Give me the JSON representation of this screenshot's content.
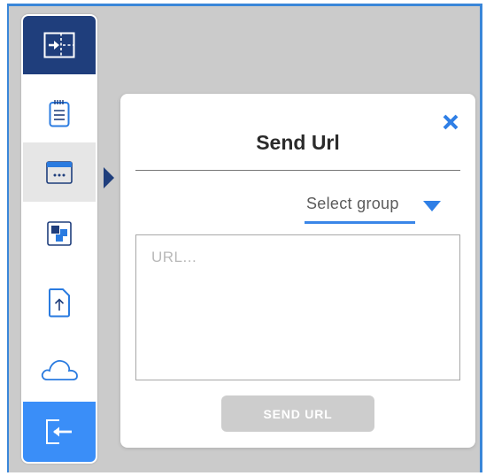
{
  "dialog": {
    "title": "Send Url",
    "close_icon": "close-icon",
    "group_select": {
      "label": "Select group",
      "icon": "caret-down-icon"
    },
    "url_input": {
      "placeholder": "URL...",
      "value": ""
    },
    "send_button": {
      "label": "SEND URL"
    }
  },
  "sidebar": {
    "items": [
      {
        "name": "collapse-sidebar",
        "icon": "collapse-sidebar-icon",
        "state": "header"
      },
      {
        "name": "notes",
        "icon": "notepad-icon",
        "state": "normal"
      },
      {
        "name": "browser",
        "icon": "browser-window-icon",
        "state": "active"
      },
      {
        "name": "tiles",
        "icon": "tiles-icon",
        "state": "normal"
      },
      {
        "name": "upload",
        "icon": "upload-file-icon",
        "state": "normal"
      },
      {
        "name": "cloud",
        "icon": "cloud-icon",
        "state": "normal"
      },
      {
        "name": "exit",
        "icon": "exit-icon",
        "state": "highlight"
      }
    ]
  },
  "colors": {
    "accent": "#3a86e8",
    "sidebar_header": "#1f3e7c",
    "exit_button": "#3a8ef8",
    "background": "#cbcbcb",
    "disabled_button": "#cdcdcd"
  }
}
